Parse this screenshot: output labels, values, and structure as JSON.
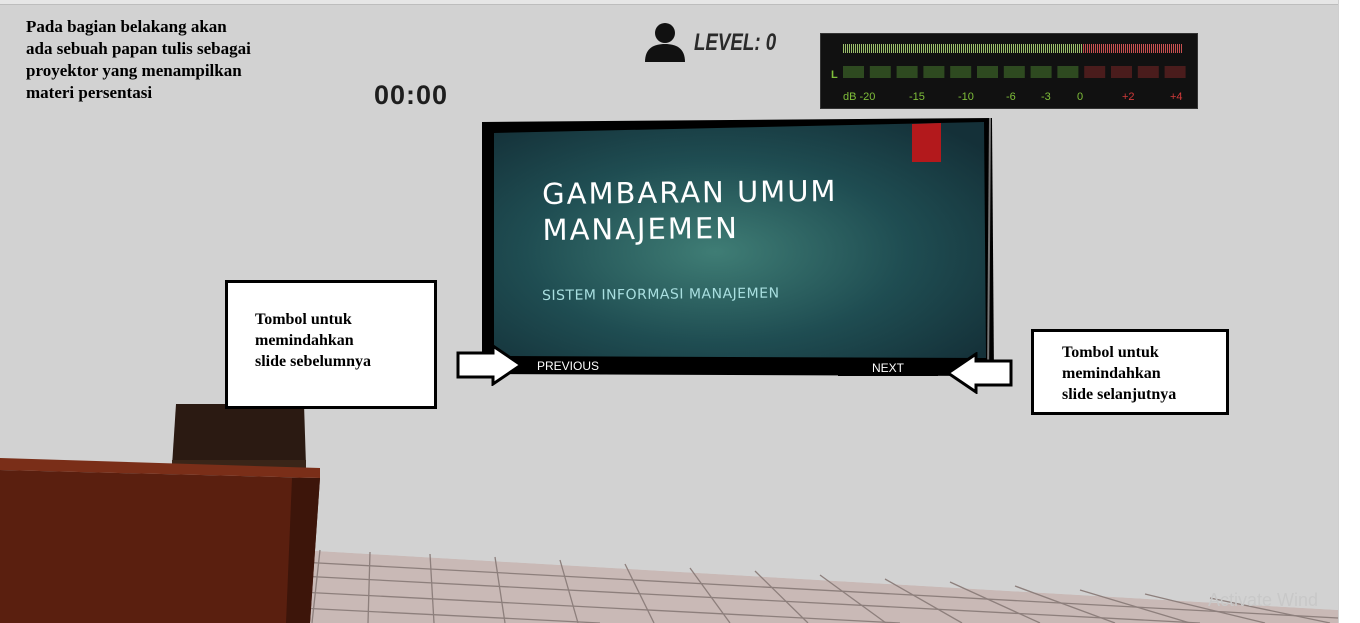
{
  "caption": {
    "lines": [
      "Pada bagian belakang akan",
      "ada sebuah papan tulis sebagai",
      "proyektor yang menampilkan",
      "materi persentasi"
    ]
  },
  "hud": {
    "timer": "00:00",
    "level_label": "LEVEL: 0",
    "player_icon": "user-icon"
  },
  "meter": {
    "channel_label": "L",
    "scale_labels": [
      "dB -20",
      "-15",
      "-10",
      "-6",
      "-3",
      "0",
      "+2",
      "+4"
    ],
    "colors": {
      "green": "#7fbf3a",
      "red": "#d23a3a",
      "background": "#111111"
    }
  },
  "slide": {
    "title_line1": "GAMBARAN UMUM",
    "title_line2": "MANAJEMEN",
    "subtitle": "SISTEM INFORMASI MANAJEMEN",
    "accent_color": "#b3191c"
  },
  "nav": {
    "previous_label": "PREVIOUS",
    "next_label": "NEXT"
  },
  "callouts": {
    "left": [
      "Tombol untuk",
      "memindahkan",
      "slide sebelumnya"
    ],
    "right": [
      "Tombol untuk",
      "memindahkan",
      "slide selanjutnya"
    ]
  },
  "watermark": "Activate Wind"
}
